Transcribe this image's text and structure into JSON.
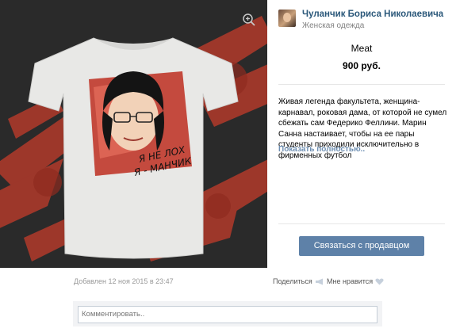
{
  "photo": {
    "shirt_text_line1": "Я НЕ ЛОХ",
    "shirt_text_line2": "Я - МАНЧИК",
    "zoom_icon": "zoom-in-icon"
  },
  "seller": {
    "name": "Чуланчик Бориса Николаевича",
    "category": "Женская одежда"
  },
  "product": {
    "title": "Meat",
    "price": "900 руб.",
    "description": "Живая легенда факультета, женщина-карнавал, роковая дама, от которой не сумел сбежать сам Федерико Феллини. Марин Санна настаивает, чтобы на ее пары студенты приходили исключительно в фирменных футбол",
    "show_more": "Показать полностью.."
  },
  "actions": {
    "contact_seller": "Связаться с продавцом",
    "share": "Поделиться",
    "like": "Мне нравится"
  },
  "meta": {
    "added": "Добавлен 12 ноя 2015 в 23:47"
  },
  "comment": {
    "placeholder": "Комментировать.."
  },
  "colors": {
    "accent": "#5e81a8",
    "link": "#2b587a",
    "photo_bg": "#2b2b2b",
    "paint": "#b23a2a"
  }
}
